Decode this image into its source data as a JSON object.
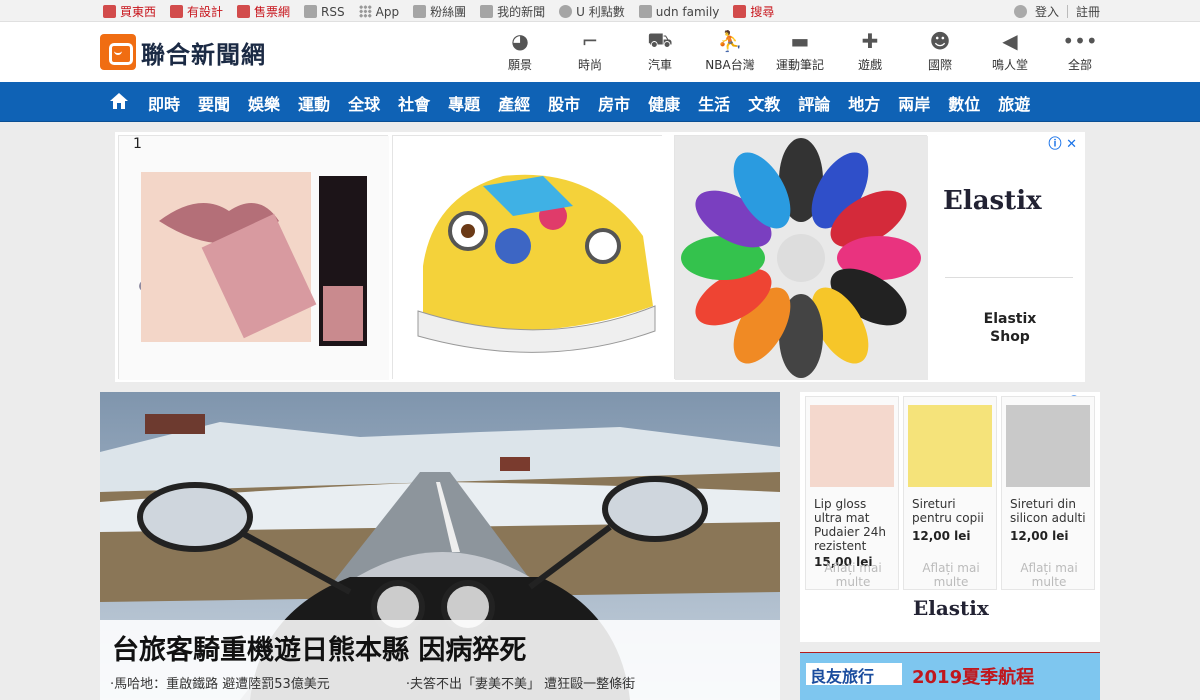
{
  "topbar": {
    "links": [
      {
        "label": "買東西",
        "icon": "shopping-bag-icon",
        "red": true
      },
      {
        "label": "有設計",
        "icon": "ud-logo-icon",
        "red": true
      },
      {
        "label": "售票網",
        "icon": "ticket-icon",
        "red": true
      },
      {
        "label": "RSS",
        "icon": "rss-icon",
        "red": false
      },
      {
        "label": "App",
        "icon": "grid-icon",
        "red": false
      },
      {
        "label": "粉絲團",
        "icon": "facebook-icon",
        "red": false
      },
      {
        "label": "我的新聞",
        "icon": "inbox-icon",
        "red": false
      },
      {
        "label": "U 利點數",
        "icon": "coin-icon",
        "red": false
      },
      {
        "label": "udn family",
        "icon": "sitemap-icon",
        "red": false
      },
      {
        "label": "搜尋",
        "icon": "search-icon",
        "red": true
      }
    ],
    "login": "登入",
    "register": "註冊"
  },
  "header": {
    "logo_text": "聯合新聞網",
    "channels": [
      {
        "label": "願景",
        "icon": "globe-hand-icon"
      },
      {
        "label": "時尚",
        "icon": "high-heel-icon"
      },
      {
        "label": "汽車",
        "icon": "car-icon"
      },
      {
        "label": "NBA台灣",
        "icon": "nba-icon"
      },
      {
        "label": "運動筆記",
        "icon": "sneaker-icon"
      },
      {
        "label": "遊戲",
        "icon": "gamepad-icon"
      },
      {
        "label": "國際",
        "icon": "face-icon"
      },
      {
        "label": "鳴人堂",
        "icon": "megaphone-icon"
      },
      {
        "label": "全部",
        "icon": "more-dots-icon"
      }
    ]
  },
  "nav": {
    "items": [
      "即時",
      "要聞",
      "娛樂",
      "運動",
      "全球",
      "社會",
      "專題",
      "產經",
      "股市",
      "房市",
      "健康",
      "生活",
      "文教",
      "評論",
      "地方",
      "兩岸",
      "數位",
      "旅遊"
    ]
  },
  "banner_ad": {
    "index": "1",
    "brand": "Elastix",
    "shop_line1": "Elastix",
    "shop_line2": "Shop",
    "info_icon": "ⓘ",
    "close_icon": "✕"
  },
  "hero": {
    "headline": "台旅客騎重機遊日熊本縣 因病猝死",
    "subs": [
      "·馬哈地：重啟鐵路 避遭陸罰53億美元",
      "·夫答不出「妻美不美」 遭狂毆一整條街"
    ]
  },
  "side_ad": {
    "products": [
      {
        "title": "Lip gloss ultra mat Pudaier 24h rezistent",
        "price": "15,00 lei",
        "more": "Aflați mai multe"
      },
      {
        "title": "Sireturi pentru copii",
        "price": "12,00 lei",
        "more": "Aflați mai multe"
      },
      {
        "title": "Sireturi din silicon adulti",
        "price": "12,00 lei",
        "more": "Aflați mai multe"
      }
    ],
    "brand": "Elastix"
  },
  "travel_ad": {
    "logo": "良友旅行",
    "text": "2019夏季航程"
  }
}
